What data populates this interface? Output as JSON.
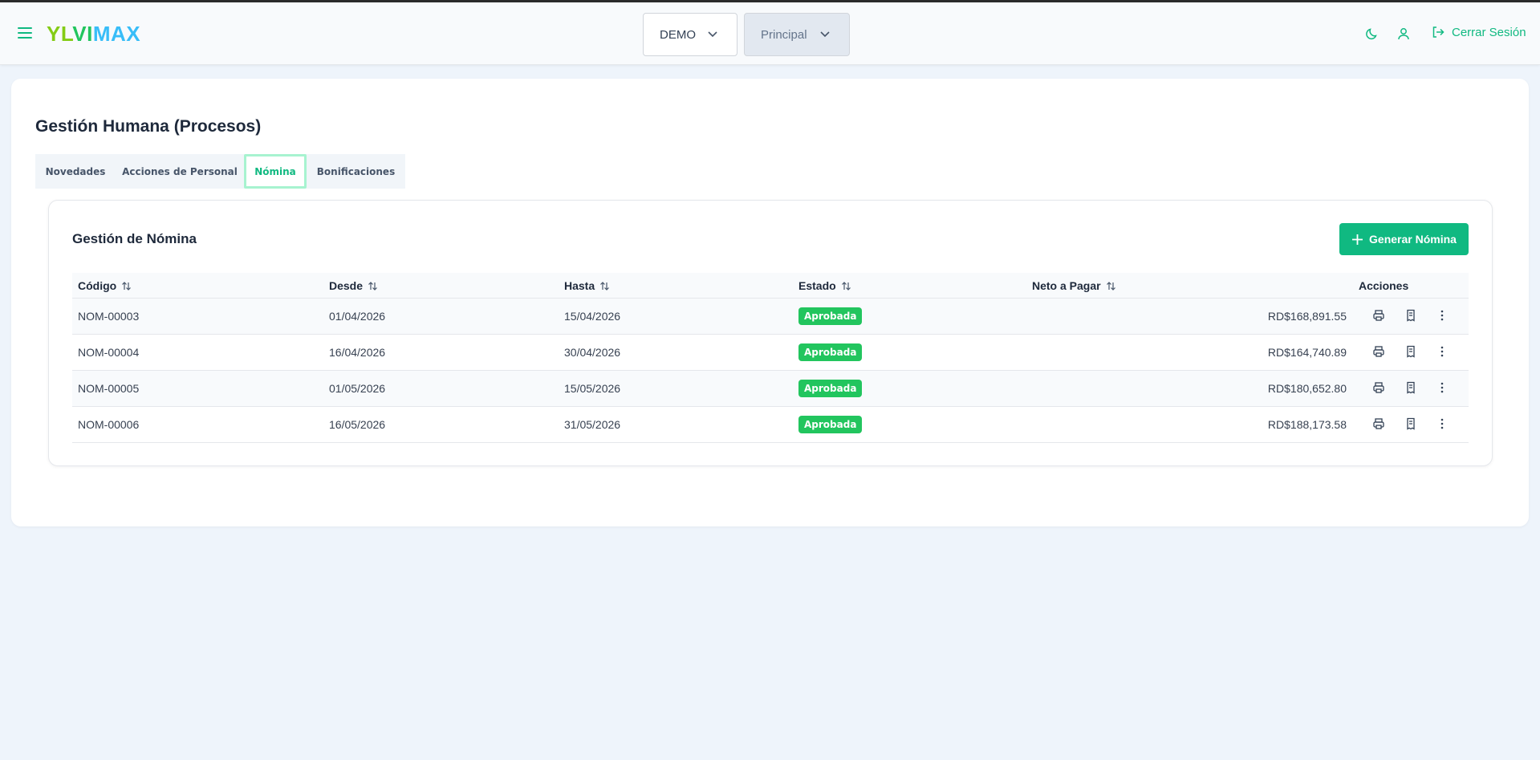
{
  "header": {
    "logo": {
      "part1": "YL",
      "part2": "VI",
      "part3": "MAX"
    },
    "company_selector": "DEMO",
    "branch_selector": "Principal",
    "logout_label": "Cerrar Sesión"
  },
  "page": {
    "title": "Gestión Humana (Procesos)",
    "tabs": [
      "Novedades",
      "Acciones de Personal",
      "Nómina",
      "Bonificaciones"
    ],
    "active_tab": "Nómina"
  },
  "payroll": {
    "title": "Gestión de Nómina",
    "generate_label": "Generar Nómina",
    "columns": {
      "code": "Código",
      "from": "Desde",
      "to": "Hasta",
      "status": "Estado",
      "net": "Neto a Pagar",
      "actions": "Acciones"
    },
    "rows": [
      {
        "code": "NOM-00003",
        "from": "01/04/2026",
        "to": "15/04/2026",
        "status": "Aprobada",
        "net": "RD$168,891.55"
      },
      {
        "code": "NOM-00004",
        "from": "16/04/2026",
        "to": "30/04/2026",
        "status": "Aprobada",
        "net": "RD$164,740.89"
      },
      {
        "code": "NOM-00005",
        "from": "01/05/2026",
        "to": "15/05/2026",
        "status": "Aprobada",
        "net": "RD$180,652.80"
      },
      {
        "code": "NOM-00006",
        "from": "16/05/2026",
        "to": "31/05/2026",
        "status": "Aprobada",
        "net": "RD$188,173.58"
      }
    ]
  },
  "colors": {
    "accent": "#10b981",
    "badge": "#22c55e",
    "background": "#eef4fb"
  }
}
